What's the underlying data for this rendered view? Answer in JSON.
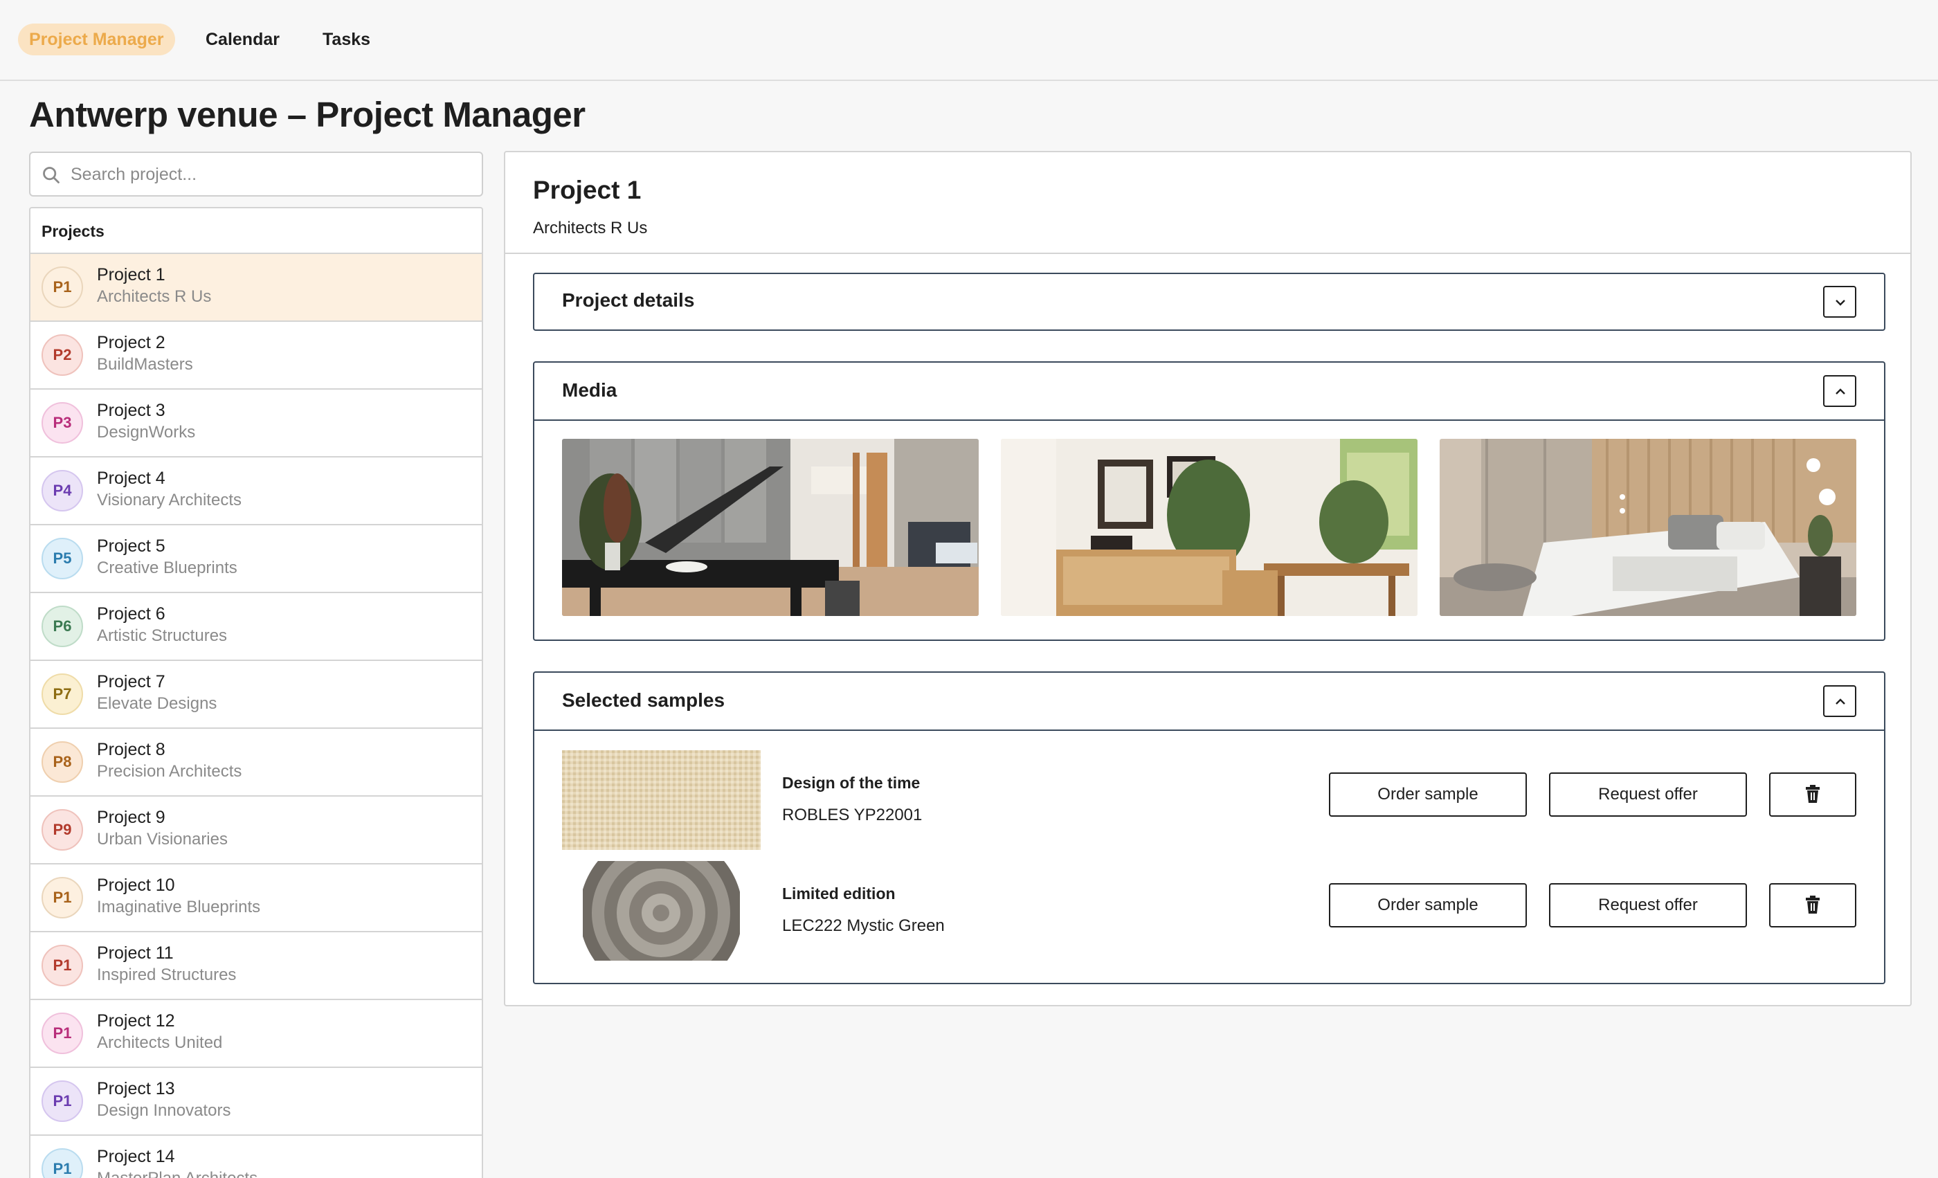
{
  "nav": {
    "items": [
      "Project Manager",
      "Calendar",
      "Tasks"
    ],
    "active_index": 0
  },
  "page": {
    "title": "Antwerp venue – Project Manager"
  },
  "search": {
    "placeholder": "Search project..."
  },
  "projects": {
    "header": "Projects",
    "items": [
      {
        "avatar": "P1",
        "name": "Project 1",
        "client": "Architects R Us",
        "color": "#a8621a",
        "bg": "#fdf0e0",
        "border": "#ead6bc"
      },
      {
        "avatar": "P2",
        "name": "Project 2",
        "client": "BuildMasters",
        "color": "#b23a2c",
        "bg": "#fbe4e1",
        "border": "#efc2bc"
      },
      {
        "avatar": "P3",
        "name": "Project 3",
        "client": "DesignWorks",
        "color": "#b82d7a",
        "bg": "#fbe3f0",
        "border": "#f0c0dc"
      },
      {
        "avatar": "P4",
        "name": "Project 4",
        "client": "Visionary Architects",
        "color": "#6b3cb0",
        "bg": "#ece4f8",
        "border": "#d5c6ef"
      },
      {
        "avatar": "P5",
        "name": "Project 5",
        "client": "Creative Blueprints",
        "color": "#2b7cae",
        "bg": "#dff0fa",
        "border": "#b9dcef"
      },
      {
        "avatar": "P6",
        "name": "Project 6",
        "client": "Artistic Structures",
        "color": "#3b7a52",
        "bg": "#e2f1e6",
        "border": "#bfdcc8"
      },
      {
        "avatar": "P7",
        "name": "Project 7",
        "client": "Elevate Designs",
        "color": "#8d6c12",
        "bg": "#fbf0d2",
        "border": "#efdca8"
      },
      {
        "avatar": "P8",
        "name": "Project 8",
        "client": "Precision Architects",
        "color": "#a8621a",
        "bg": "#fbe8d6",
        "border": "#efcfae"
      },
      {
        "avatar": "P9",
        "name": "Project 9",
        "client": "Urban Visionaries",
        "color": "#b23a2c",
        "bg": "#fbe4e1",
        "border": "#efc2bc"
      },
      {
        "avatar": "P1",
        "name": "Project 10",
        "client": "Imaginative Blueprints",
        "color": "#a8621a",
        "bg": "#fdf0e0",
        "border": "#ead6bc"
      },
      {
        "avatar": "P1",
        "name": "Project 11",
        "client": "Inspired Structures",
        "color": "#b23a2c",
        "bg": "#fbe4e1",
        "border": "#efc2bc"
      },
      {
        "avatar": "P1",
        "name": "Project 12",
        "client": "Architects United",
        "color": "#b82d7a",
        "bg": "#fbe3f0",
        "border": "#f0c0dc"
      },
      {
        "avatar": "P1",
        "name": "Project 13",
        "client": "Design Innovators",
        "color": "#6b3cb0",
        "bg": "#ece4f8",
        "border": "#d5c6ef"
      },
      {
        "avatar": "P1",
        "name": "Project 14",
        "client": "MasterPlan Architects",
        "color": "#2b7cae",
        "bg": "#dff0fa",
        "border": "#b9dcef"
      }
    ],
    "selected_index": 0
  },
  "detail": {
    "title": "Project 1",
    "client": "Architects R Us",
    "sections": {
      "details": "Project details",
      "media": "Media",
      "samples": "Selected samples"
    },
    "samples": [
      {
        "name": "Design of the time",
        "code": "ROBLES YP22001"
      },
      {
        "name": "Limited edition",
        "code": "LEC222 Mystic Green"
      }
    ],
    "buttons": {
      "order": "Order sample",
      "offer": "Request offer"
    }
  }
}
